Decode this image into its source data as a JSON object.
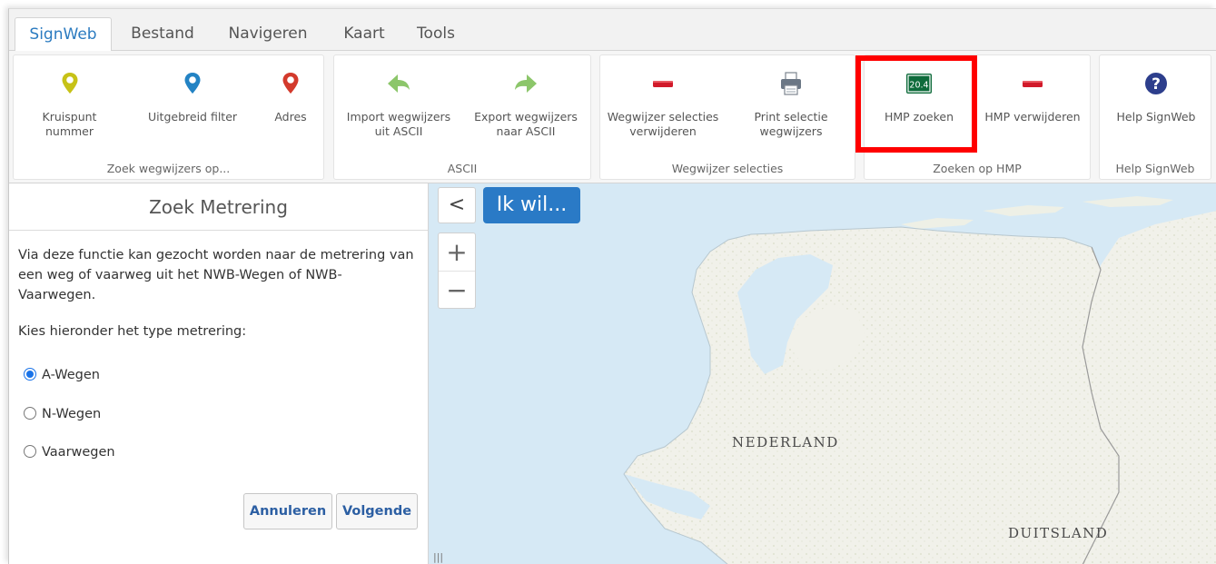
{
  "tabs": [
    {
      "label": "SignWeb",
      "active": true
    },
    {
      "label": "Bestand",
      "active": false
    },
    {
      "label": "Navigeren",
      "active": false
    },
    {
      "label": "Kaart",
      "active": false
    },
    {
      "label": "Tools",
      "active": false
    }
  ],
  "ribbon": {
    "groups": [
      {
        "label": "Zoek wegwijzers op...",
        "buttons": [
          {
            "label": "Kruispunt nummer",
            "icon": "pin-yellow-icon"
          },
          {
            "label": "Uitgebreid filter",
            "icon": "pin-blue-icon"
          },
          {
            "label": "Adres",
            "icon": "pin-red-icon"
          }
        ]
      },
      {
        "label": "ASCII",
        "buttons": [
          {
            "label": "Import wegwijzers uit ASCII",
            "icon": "arrow-left-green-icon"
          },
          {
            "label": "Export wegwijzers naar ASCII",
            "icon": "arrow-right-green-icon"
          }
        ]
      },
      {
        "label": "Wegwijzer selecties",
        "buttons": [
          {
            "label": "Wegwijzer selecties verwijderen",
            "icon": "remove-red-icon"
          },
          {
            "label": "Print selectie wegwijzers",
            "icon": "printer-icon"
          }
        ]
      },
      {
        "label": "Zoeken op HMP",
        "buttons": [
          {
            "label": "HMP zoeken",
            "icon": "hmp-sign-icon",
            "sign_text": "20.4"
          },
          {
            "label": "HMP verwijderen",
            "icon": "remove-red-icon"
          }
        ]
      },
      {
        "label": "Help SignWeb",
        "buttons": [
          {
            "label": "Help SignWeb",
            "icon": "help-icon"
          }
        ]
      }
    ]
  },
  "panel": {
    "title": "Zoek Metrering",
    "description": "Via deze functie kan gezocht worden naar de metrering van een weg of vaarweg uit het NWB-Wegen of NWB-Vaarwegen.",
    "prompt": "Kies hieronder het type metrering:",
    "options": [
      {
        "label": "A-Wegen",
        "selected": true
      },
      {
        "label": "N-Wegen",
        "selected": false
      },
      {
        "label": "Vaarwegen",
        "selected": false
      }
    ],
    "cancel_label": "Annuleren",
    "next_label": "Volgende"
  },
  "map": {
    "ikwil_label": "Ik wil...",
    "collapse_glyph": "<",
    "zoom_in": "+",
    "zoom_out": "−",
    "labels": [
      "NEDERLAND",
      "DUITSLAND"
    ],
    "splitter_glyph": "|||"
  },
  "colors": {
    "accent": "#2a7ac6",
    "highlight": "#ff0000",
    "water": "#d6e9f5",
    "land": "#f1f1ea"
  }
}
